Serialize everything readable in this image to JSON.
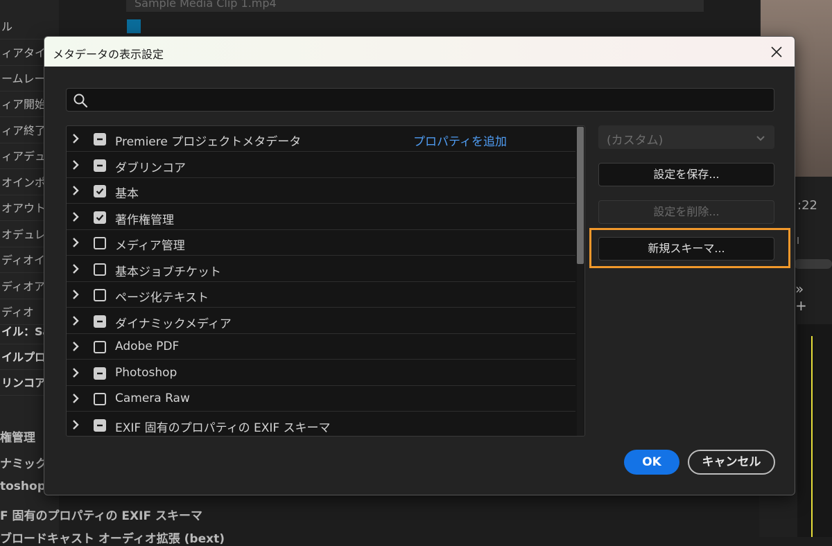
{
  "background": {
    "top_field_text": "Sample Media Clip 1.mp4",
    "left_rows": [
      "ル",
      "ィアタイ",
      "ームレー",
      "ィア開始",
      "ィア終了",
      "ィアデュ",
      "オインポ",
      "オアウト",
      "オデュレ",
      "ディオイ",
      "ディオア",
      "ディオ"
    ],
    "left_rows_bold": [
      "イル：Sa",
      "イルプロ",
      "リンコア"
    ],
    "bottom_rows": [
      "権管理",
      "ナミック",
      "toshop",
      "F 固有のプロパティの EXIF スキーマ",
      "ブロードキャスト オーディオ拡張 (bext)"
    ],
    "timecode": ":22",
    "tools": "» +"
  },
  "dialog": {
    "title": "メタデータの表示設定",
    "search": {
      "value": "",
      "placeholder": ""
    },
    "add_property_label": "プロパティを追加",
    "rows": [
      {
        "label": "Premiere プロジェクトメタデータ",
        "state": "mixed"
      },
      {
        "label": "ダブリンコア",
        "state": "mixed"
      },
      {
        "label": "基本",
        "state": "checked"
      },
      {
        "label": "著作権管理",
        "state": "checked"
      },
      {
        "label": "メディア管理",
        "state": "unchecked"
      },
      {
        "label": "基本ジョブチケット",
        "state": "unchecked"
      },
      {
        "label": "ページ化テキスト",
        "state": "unchecked"
      },
      {
        "label": "ダイナミックメディア",
        "state": "mixed"
      },
      {
        "label": "Adobe PDF",
        "state": "unchecked"
      },
      {
        "label": "Photoshop",
        "state": "mixed"
      },
      {
        "label": "Camera Raw",
        "state": "unchecked"
      },
      {
        "label": "EXIF 固有のプロパティの EXIF スキーマ",
        "state": "mixed"
      }
    ],
    "preset_value": "(カスタム)",
    "save_label": "設定を保存...",
    "delete_label": "設定を削除...",
    "new_schema_label": "新規スキーマ...",
    "ok_label": "OK",
    "cancel_label": "キャンセル"
  },
  "colors": {
    "accent": "#1473e6",
    "link": "#4f9cf2",
    "highlight": "#f1982b"
  }
}
